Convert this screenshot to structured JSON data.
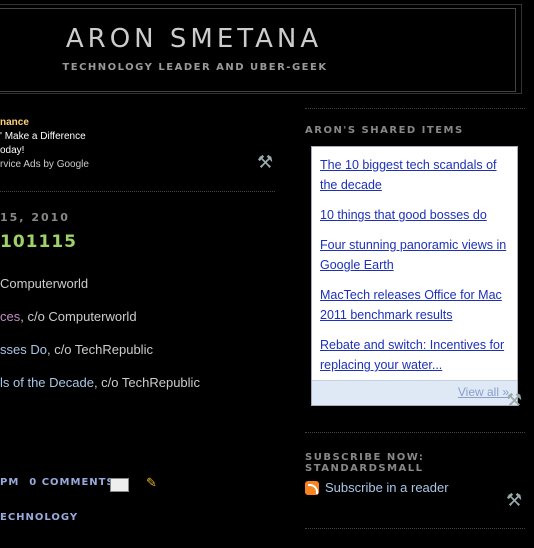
{
  "header": {
    "title": "ARON SMETANA",
    "description": "TECHNOLOGY LEADER AND UBER-GEEK"
  },
  "ad": {
    "line1": "nance",
    "line2": "' Make a Difference",
    "line3": "oday!",
    "line4": "rvice Ads by Google"
  },
  "post": {
    "date": "15, 2010",
    "title": "101115",
    "lines": [
      {
        "a": "",
        "b": "Computerworld"
      },
      {
        "a": "ces",
        "b": ", c/o Computerworld"
      },
      {
        "a": "sses Do",
        "b": ", c/o TechRepublic"
      },
      {
        "a": "ls of the Decade",
        "b": ", c/o TechRepublic"
      }
    ],
    "footer_time": "PM",
    "footer_comments": "0 COMMENTS",
    "labels": "ECHNOLOGY"
  },
  "sidebar": {
    "shared_title": "ARON'S SHARED ITEMS",
    "shared_items": [
      "The 10 biggest tech scandals of the decade",
      "10 things that good bosses do",
      "Four stunning panoramic views in Google Earth",
      "MacTech releases Office for Mac 2011 benchmark results",
      "Rebate and switch: Incentives for replacing your water..."
    ],
    "view_all": "View all »",
    "subscribe_title": "SUBSCRIBE NOW: STANDARDSMALL",
    "subscribe_link": "Subscribe in a reader"
  }
}
